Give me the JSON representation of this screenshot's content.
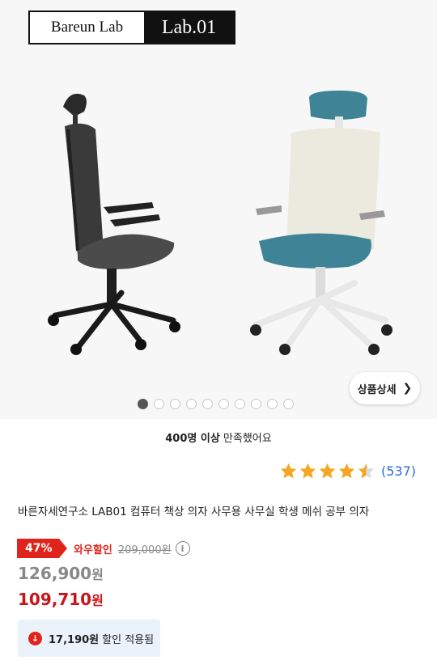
{
  "brand": {
    "left": "Bareun Lab",
    "right": "Lab.01"
  },
  "gallery": {
    "detail_button": "상품상세",
    "dot_count": 10,
    "active_dot": 0
  },
  "satisfaction": {
    "bold": "400명 이상",
    "rest": " 만족했어요"
  },
  "rating": {
    "stars": 4.5,
    "count": "(537)",
    "star_color": "#f5a623"
  },
  "product": {
    "title": "바른자세연구소 LAB01 컴퓨터 책상 의자 사무용 사무실 학생 메쉬 공부 의자"
  },
  "pricing": {
    "discount_rate": "47%",
    "discount_label": "와우할인",
    "original_price": "209,000원",
    "info_icon": "i",
    "price_amount": "126,900",
    "wow_price_amount": "109,710",
    "currency": "원",
    "accent_color": "#e0241b"
  },
  "coupon": {
    "amount": "17,190원",
    "text": "할인 적용됨",
    "icon": "↓"
  }
}
